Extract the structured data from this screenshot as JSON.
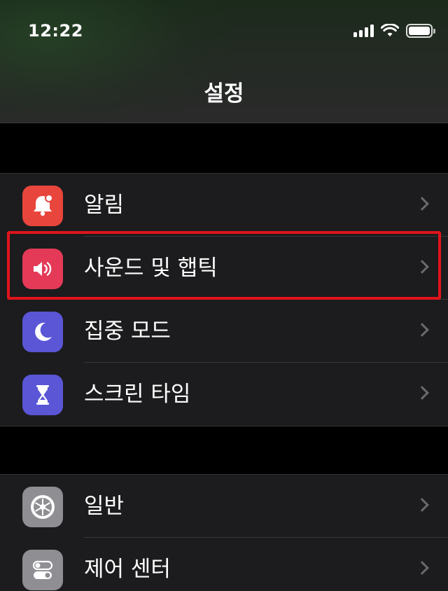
{
  "status_bar": {
    "time": "12:22",
    "icons": [
      "cellular-signal-icon",
      "wifi-icon",
      "battery-icon"
    ]
  },
  "header": {
    "title": "설정"
  },
  "groups": [
    {
      "items": [
        {
          "label": "알림",
          "icon": "bell-icon",
          "icon_color": "#e8453c"
        },
        {
          "label": "사운드 및 햅틱",
          "icon": "speaker-icon",
          "icon_color": "#e43a58",
          "highlighted": true
        },
        {
          "label": "집중 모드",
          "icon": "moon-icon",
          "icon_color": "#5a56d6"
        },
        {
          "label": "스크린 타임",
          "icon": "hourglass-icon",
          "icon_color": "#5a56d6"
        }
      ]
    },
    {
      "items": [
        {
          "label": "일반",
          "icon": "gear-icon",
          "icon_color": "#8e8e93"
        },
        {
          "label": "제어 센터",
          "icon": "toggles-icon",
          "icon_color": "#8e8e93"
        }
      ]
    }
  ],
  "colors": {
    "highlight_border": "#e0141c",
    "row_background": "#1c1c1e",
    "chevron": "#6a6a6e"
  }
}
